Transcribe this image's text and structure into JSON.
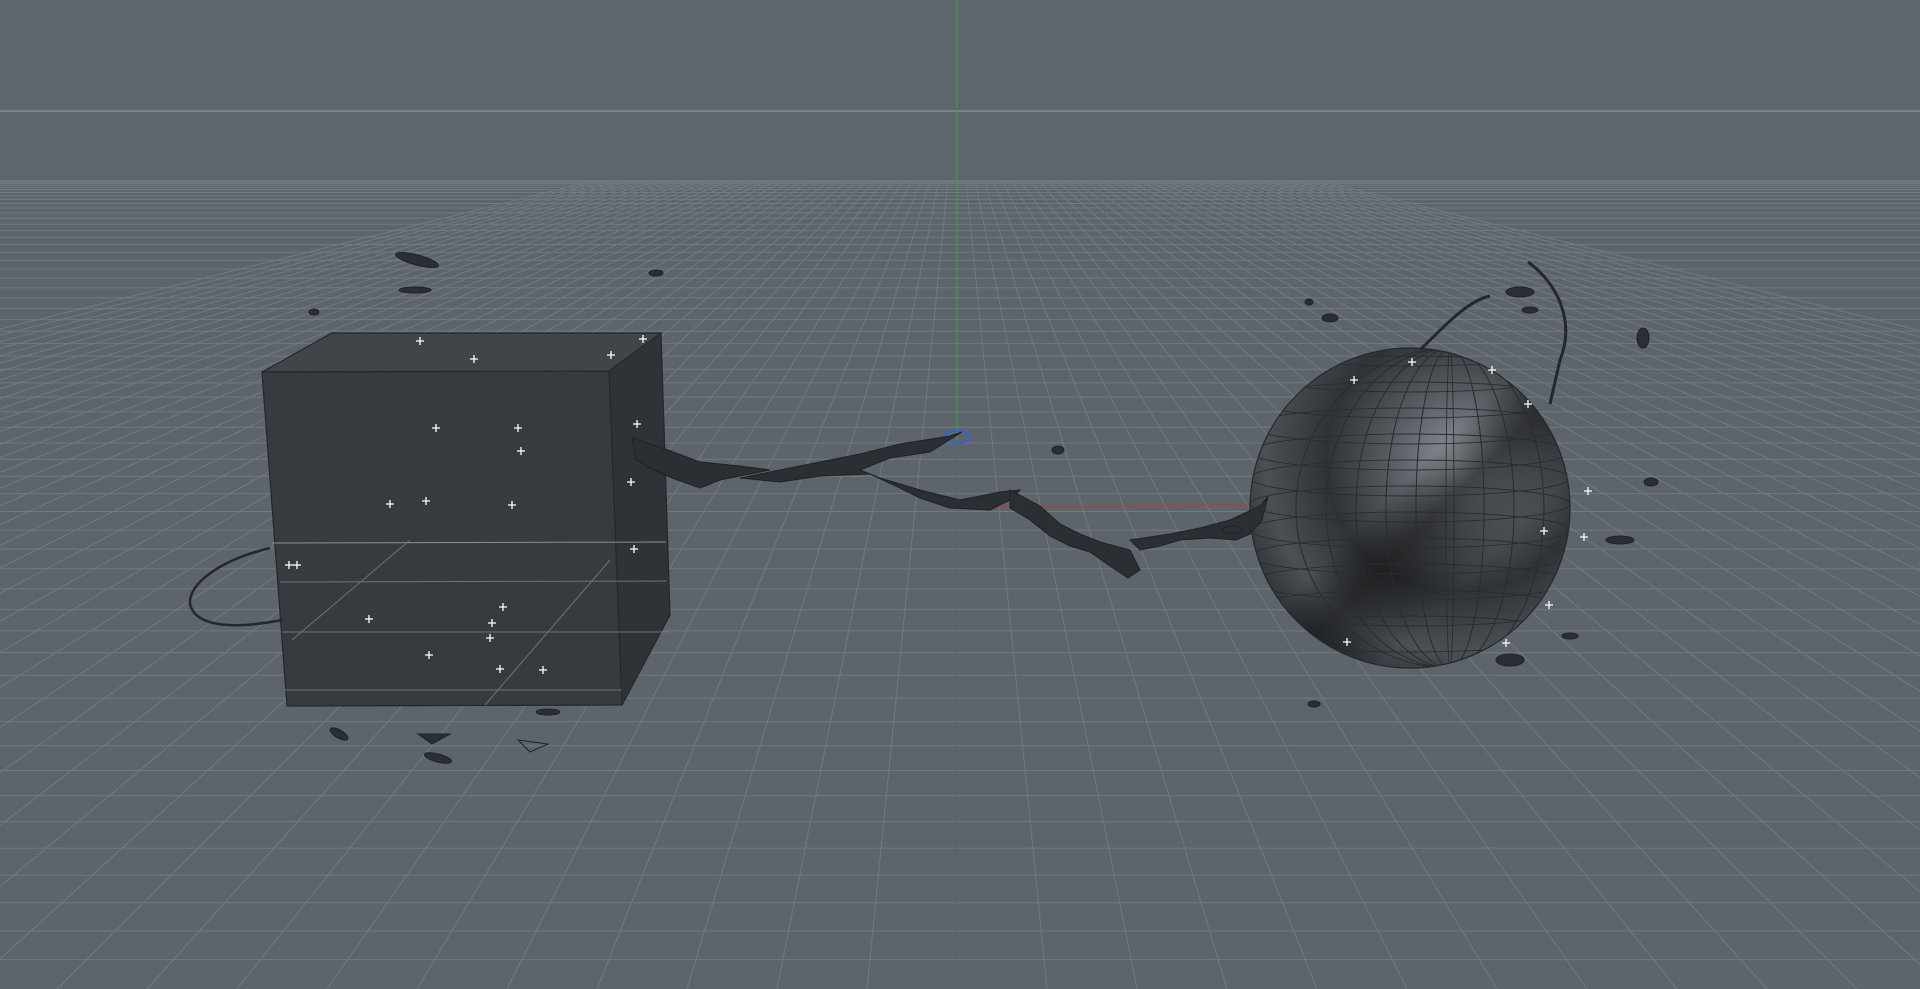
{
  "viewport": {
    "panel": "3d-perspective-viewport",
    "background_color": "#5d646b",
    "floor_grid_color": "#727980",
    "horizon_color": "#4a5056",
    "axis_colors": {
      "x": "#c0392b",
      "y": "#2fa84f",
      "z": "#3a5fd0"
    },
    "objects": [
      {
        "name": "cube",
        "type": "polygon-cube",
        "color": "#3a3e43"
      },
      {
        "name": "sphere",
        "type": "polygon-sphere",
        "color": "#3c4045"
      },
      {
        "name": "fluid-splash",
        "type": "particle-mesh",
        "color": "#2a2d31"
      }
    ],
    "particle_marker": "+",
    "grid_visible": true
  }
}
